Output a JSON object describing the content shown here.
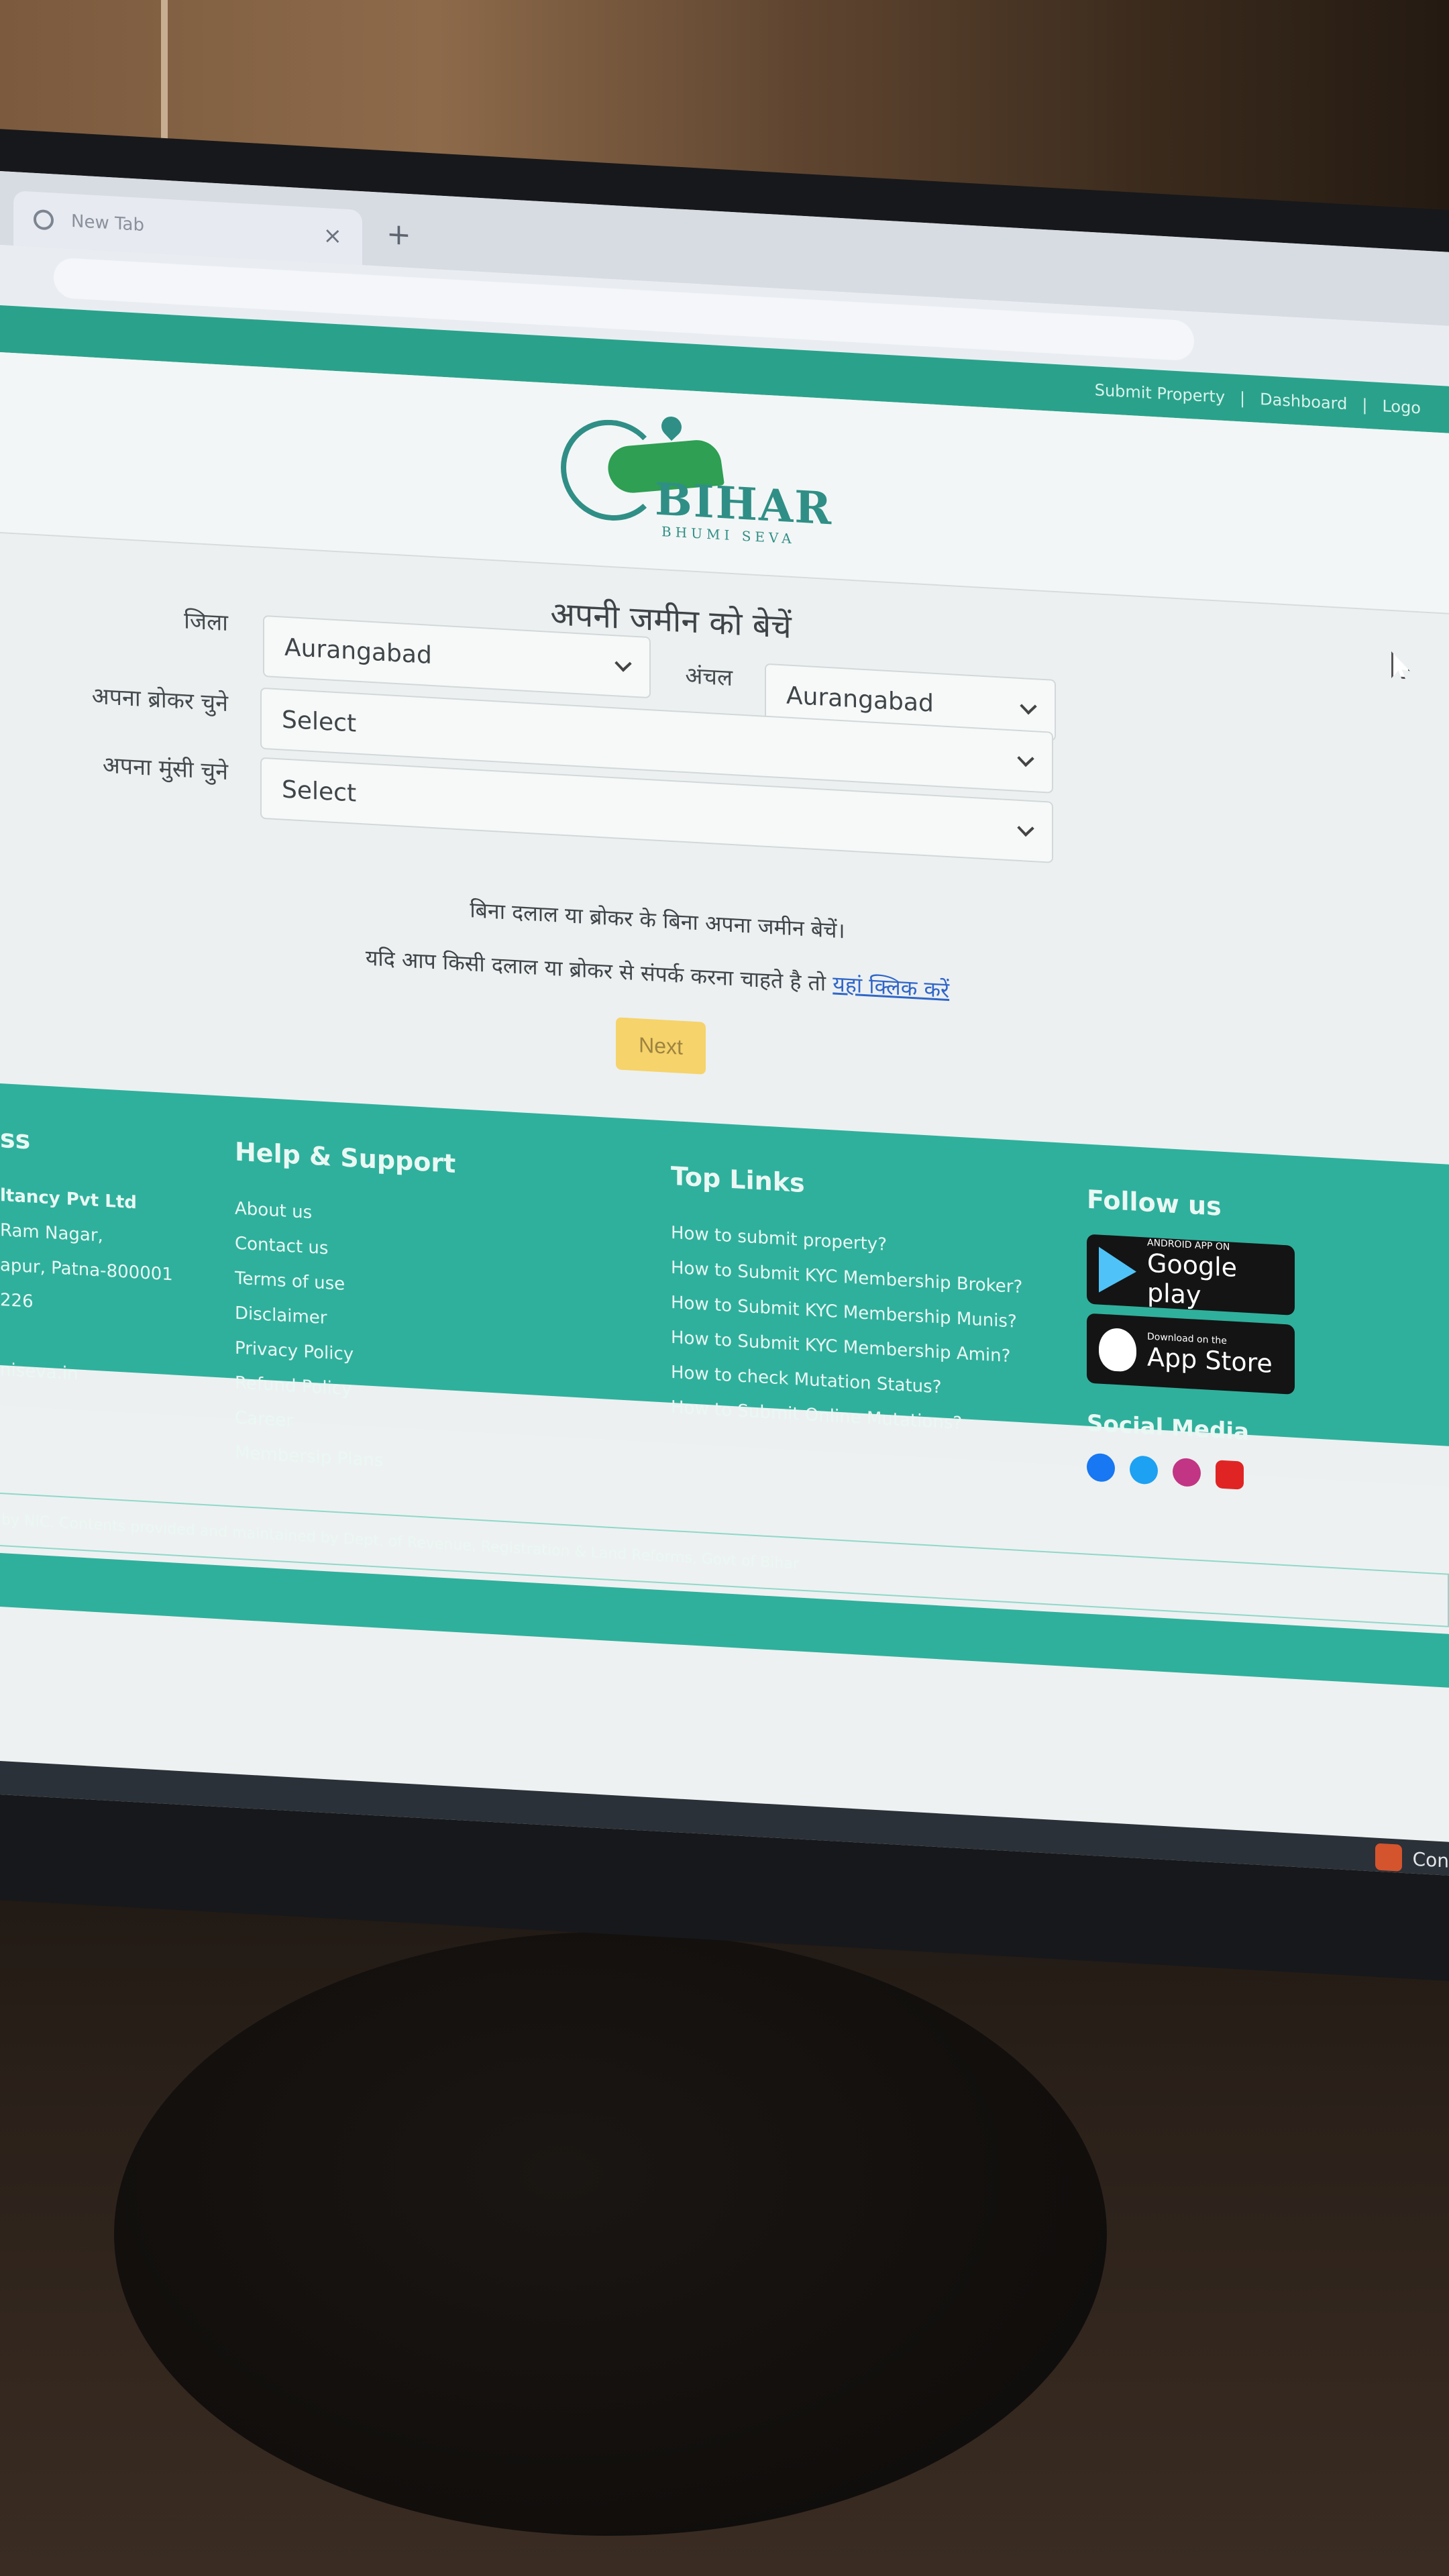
{
  "browser": {
    "tab_title": "New Tab",
    "close_glyph": "×",
    "new_tab_glyph": "+"
  },
  "topbar": {
    "links": [
      "Submit Property",
      "Dashboard",
      "Logo"
    ],
    "separator": "|"
  },
  "logo": {
    "word": "BIHAR",
    "sub": "BHUMI SEVA"
  },
  "form": {
    "title": "अपनी जमीन को बेचें",
    "district_label": "जिला",
    "district_value": "Aurangabad",
    "circle_label": "अंचल",
    "circle_value": "Aurangabad",
    "broker_label": "अपना ब्रोकर चुने",
    "broker_value": "Select",
    "munshi_label": "अपना मुंसी चुने",
    "munshi_value": "Select",
    "info_line1": "बिना दलाल या ब्रोकर के बिना अपना जमीन बेचें।",
    "info_line2_prefix": "यदि आप किसी दलाल या ब्रोकर से संपर्क करना चाहते है तो ",
    "info_line2_link": "यहां क्लिक करें",
    "next_label": "Next"
  },
  "footer": {
    "address_heading": "ss",
    "address_lines": [
      "ltancy Pvt Ltd",
      "Ram Nagar,",
      "apur, Patna-800001",
      "226",
      "",
      "niseva.in"
    ],
    "help_heading": "Help & Support",
    "help_links": [
      "About us",
      "Contact us",
      "Terms of use",
      "Disclaimer",
      "Privacy Policy",
      "Refund Policy",
      "Career",
      "Membersip Plans"
    ],
    "top_heading": "Top Links",
    "top_links": [
      "How to submit property?",
      "How to Submit KYC Membership Broker?",
      "How to Submit KYC Membership Munis?",
      "How to Submit KYC Membership Amin?",
      "How to check Mutation Status?",
      "How to Submit Online Mutations?"
    ],
    "follow_heading": "Follow us",
    "google_small": "ANDROID APP ON",
    "google_big": "Google play",
    "apple_small": "Download on the",
    "apple_big": "App Store",
    "social_heading": "Social Media",
    "copyright": "by NIC. Contents provided and maintained by Dept. of Revenue, Registration & Land Reforms, Govt of Bihar"
  },
  "taskbar": {
    "tray_text": "Con"
  },
  "colors": {
    "brand": "#2fb09c",
    "button": "#f6d36b",
    "link": "#2f66c8"
  }
}
